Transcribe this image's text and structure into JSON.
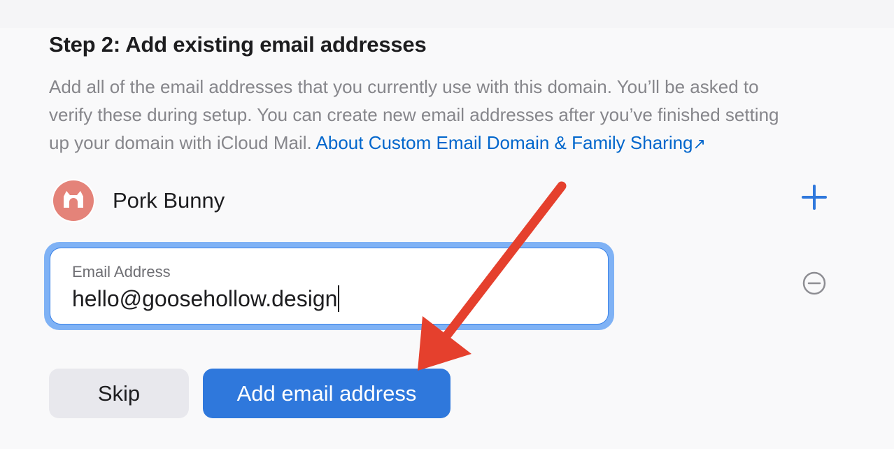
{
  "step": {
    "title": "Step 2: Add existing email addresses",
    "description_line1": "Add all of the email addresses that you currently use with this domain. You’ll be asked to",
    "description_line2": "verify these during setup. You can create new email addresses after you’ve finished setting",
    "description_line3_prefix": "up your domain with iCloud Mail.",
    "link_label": "About Custom Email Domain & Family Sharing",
    "link_arrow": "↗"
  },
  "provider": {
    "name": "Pork Bunny",
    "logo_icon": "porkbunny-logo",
    "logo_color": "#e48379"
  },
  "email_field": {
    "label": "Email Address",
    "value": "hello@goosehollow.design"
  },
  "buttons": {
    "skip_label": "Skip",
    "add_label": "Add email address"
  },
  "icons": {
    "add": "plus-icon",
    "remove": "minus-circle-icon"
  },
  "colors": {
    "accent": "#2f78dc",
    "link": "#0066cc",
    "annotation_arrow": "#e5402d"
  }
}
